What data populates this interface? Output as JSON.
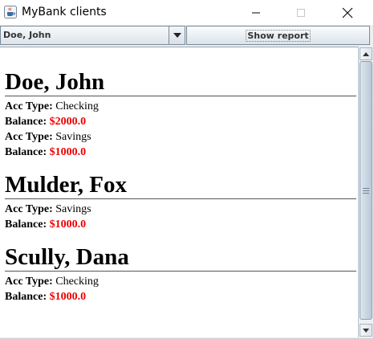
{
  "window": {
    "title": "MyBank clients",
    "icon": "java-coffee-cup-icon"
  },
  "toolbar": {
    "client_select_value": "Doe, John",
    "show_report_label": "Show report"
  },
  "report": {
    "clients": [
      {
        "name": "Doe, John",
        "accounts": [
          {
            "type_label": "Acc Type:",
            "type": "Checking",
            "balance_label": "Balance:",
            "balance": "$2000.0"
          },
          {
            "type_label": "Acc Type:",
            "type": "Savings",
            "balance_label": "Balance:",
            "balance": "$1000.0"
          }
        ]
      },
      {
        "name": "Mulder, Fox",
        "accounts": [
          {
            "type_label": "Acc Type:",
            "type": "Savings",
            "balance_label": "Balance:",
            "balance": "$1000.0"
          }
        ]
      },
      {
        "name": "Scully, Dana",
        "accounts": [
          {
            "type_label": "Acc Type:",
            "type": "Checking",
            "balance_label": "Balance:",
            "balance": "$1000.0"
          }
        ]
      }
    ]
  },
  "colors": {
    "balance": "#ee0000"
  }
}
